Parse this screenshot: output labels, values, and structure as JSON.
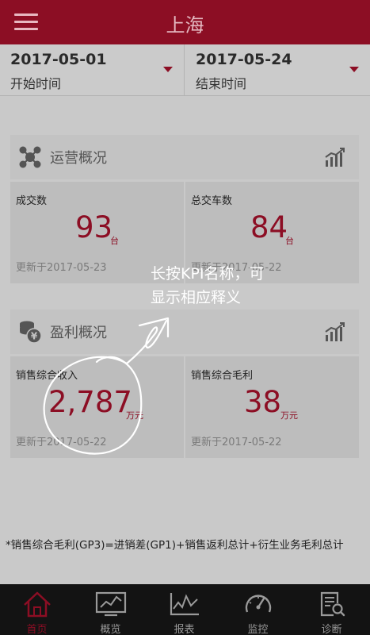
{
  "header": {
    "title": "上海",
    "menu_icon": "menu-icon"
  },
  "date_range": {
    "start": {
      "value": "2017-05-01",
      "label": "开始时间"
    },
    "end": {
      "value": "2017-05-24",
      "label": "结束时间"
    }
  },
  "operations": {
    "title": "运营概况",
    "icon": "network-icon",
    "cards": [
      {
        "name": "成交数",
        "value": "93",
        "unit": "台",
        "updated": "更新于2017-05-23"
      },
      {
        "name": "总交车数",
        "value": "84",
        "unit": "台",
        "updated": "更新于2017-05-22"
      }
    ]
  },
  "profit": {
    "title": "盈利概况",
    "icon": "coins-yen-icon",
    "cards": [
      {
        "name": "销售综合收入",
        "value": "2,787",
        "unit": "万元",
        "updated": "更新于2017-05-22"
      },
      {
        "name": "销售综合毛利",
        "value": "38",
        "unit": "万元",
        "updated": "更新于2017-05-22"
      }
    ]
  },
  "tooltip": {
    "line1": "长按KPI名称，可",
    "line2": "显示相应释义"
  },
  "footnote": "*销售综合毛利(GP3)=进销差(GP1)+销售返利总计+衍生业务毛利总计",
  "nav": [
    {
      "label": "首页",
      "icon": "home-icon",
      "active": true
    },
    {
      "label": "概览",
      "icon": "overview-chart-icon",
      "active": false
    },
    {
      "label": "报表",
      "icon": "report-chart-icon",
      "active": false
    },
    {
      "label": "监控",
      "icon": "speedometer-icon",
      "active": false
    },
    {
      "label": "诊断",
      "icon": "diagnosis-icon",
      "active": false
    }
  ],
  "colors": {
    "brand": "#8c0e24",
    "overlay_bg": "#c9c9c9",
    "nav_bg": "#131313"
  }
}
